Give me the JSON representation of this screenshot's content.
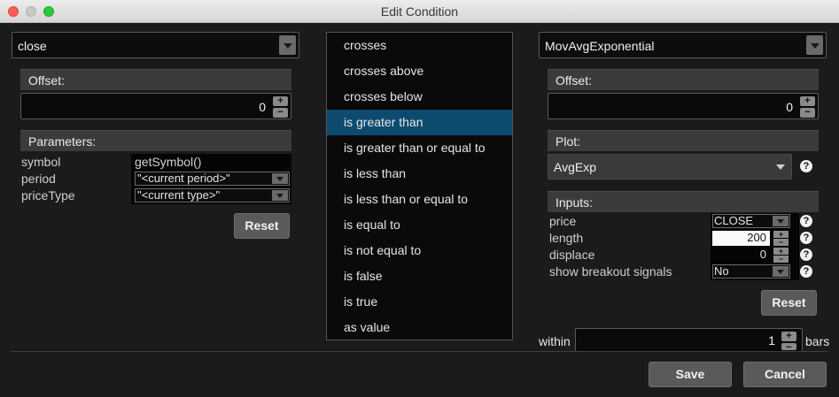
{
  "window": {
    "title": "Edit Condition"
  },
  "left": {
    "field_value": "close",
    "offset_label": "Offset:",
    "offset_value": "0",
    "parameters_label": "Parameters:",
    "params": [
      {
        "key": "symbol",
        "value": "getSymbol()"
      },
      {
        "key": "period",
        "value": "\"<current period>\""
      },
      {
        "key": "priceType",
        "value": "\"<current type>\""
      }
    ],
    "reset_label": "Reset"
  },
  "operators": {
    "selected": "is greater than",
    "items": [
      "crosses",
      "crosses above",
      "crosses below",
      "is greater than",
      "is greater than or equal to",
      "is less than",
      "is less than or equal to",
      "is equal to",
      "is not equal to",
      "is false",
      "is true",
      "as value"
    ]
  },
  "right": {
    "study_value": "MovAvgExponential",
    "offset_label": "Offset:",
    "offset_value": "0",
    "plot_label": "Plot:",
    "plot_value": "AvgExp",
    "inputs_label": "Inputs:",
    "inputs": [
      {
        "key": "price",
        "value": "CLOSE"
      },
      {
        "key": "length",
        "value": "200"
      },
      {
        "key": "displace",
        "value": "0"
      },
      {
        "key": "show breakout signals",
        "value": "No"
      }
    ],
    "reset_label": "Reset",
    "within_label": "within",
    "within_value": "1",
    "bars_label": "bars"
  },
  "footer": {
    "save_label": "Save",
    "cancel_label": "Cancel"
  },
  "colors": {
    "selection": "#0d4b6e",
    "background": "#1b1b1b"
  }
}
